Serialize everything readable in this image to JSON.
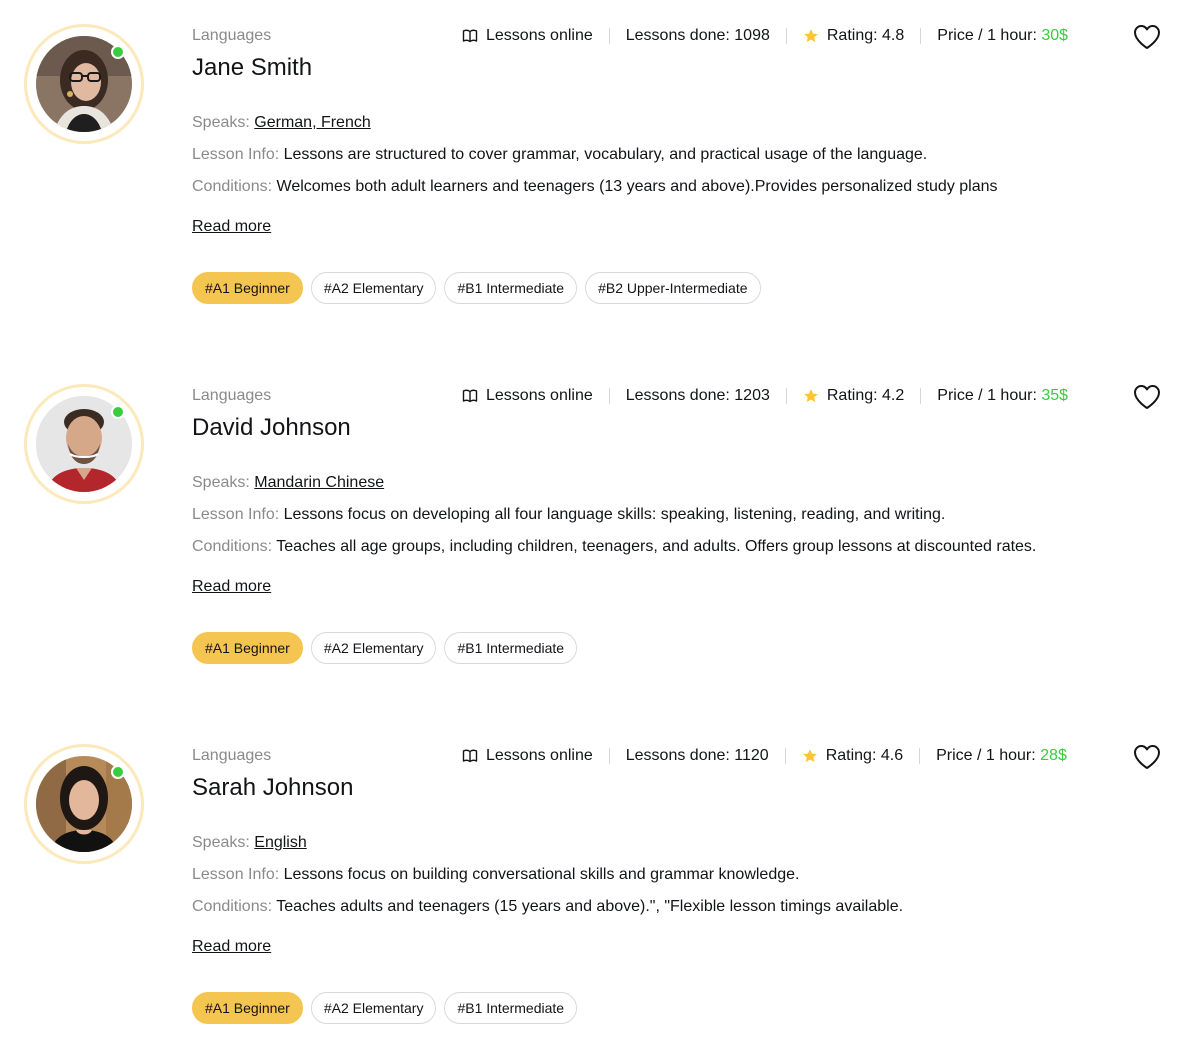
{
  "colors": {
    "accent": "#f4c550",
    "price": "#38cd3e",
    "online": "#38cd3e",
    "avatar_ring": "#fbe9ba",
    "muted_text": "#8a8a89"
  },
  "teachers": [
    {
      "category": "Languages",
      "name": "Jane Smith",
      "stats": {
        "lessons_online": "Lessons online",
        "lessons_done_label": "Lessons done: ",
        "lessons_done": "1098",
        "rating_label": "Rating: ",
        "rating": "4.8",
        "price_label": "Price / 1 hour: ",
        "price": "30$"
      },
      "speaks_label": "Speaks: ",
      "speaks": "German, French",
      "lesson_info_label": "Lesson Info: ",
      "lesson_info": "Lessons are structured to cover grammar, vocabulary, and practical usage of the language.",
      "conditions_label": "Conditions: ",
      "conditions": "Welcomes both adult learners and teenagers (13 years and above).Provides personalized study plans",
      "read_more": "Read more",
      "levels": [
        "#A1 Beginner",
        "#A2 Elementary",
        "#B1 Intermediate",
        "#B2 Upper-Intermediate"
      ],
      "selected_level": "#A1 Beginner"
    },
    {
      "category": "Languages",
      "name": "David Johnson",
      "stats": {
        "lessons_online": "Lessons online",
        "lessons_done_label": "Lessons done: ",
        "lessons_done": "1203",
        "rating_label": "Rating: ",
        "rating": "4.2",
        "price_label": "Price / 1 hour: ",
        "price": "35$"
      },
      "speaks_label": "Speaks: ",
      "speaks": "Mandarin Chinese",
      "lesson_info_label": "Lesson Info: ",
      "lesson_info": "Lessons focus on developing all four language skills: speaking, listening, reading, and writing.",
      "conditions_label": "Conditions: ",
      "conditions": "Teaches all age groups, including children, teenagers, and adults. Offers group lessons at discounted rates.",
      "read_more": "Read more",
      "levels": [
        "#A1 Beginner",
        "#A2 Elementary",
        "#B1 Intermediate"
      ],
      "selected_level": "#A1 Beginner"
    },
    {
      "category": "Languages",
      "name": "Sarah Johnson",
      "stats": {
        "lessons_online": "Lessons online",
        "lessons_done_label": "Lessons done: ",
        "lessons_done": "1120",
        "rating_label": "Rating: ",
        "rating": "4.6",
        "price_label": "Price / 1 hour: ",
        "price": "28$"
      },
      "speaks_label": "Speaks: ",
      "speaks": "English",
      "lesson_info_label": "Lesson Info: ",
      "lesson_info": "Lessons focus on building conversational skills and grammar knowledge.",
      "conditions_label": "Conditions: ",
      "conditions": "Teaches adults and teenagers (15 years and above).\", \"Flexible lesson timings available.",
      "read_more": "Read more",
      "levels": [
        "#A1 Beginner",
        "#A2 Elementary",
        "#B1 Intermediate"
      ],
      "selected_level": "#A1 Beginner"
    }
  ],
  "icons": {
    "lessons_online": "book-open-icon",
    "rating": "star-icon",
    "favorite": "heart-icon",
    "online_status": "online-status-dot"
  }
}
